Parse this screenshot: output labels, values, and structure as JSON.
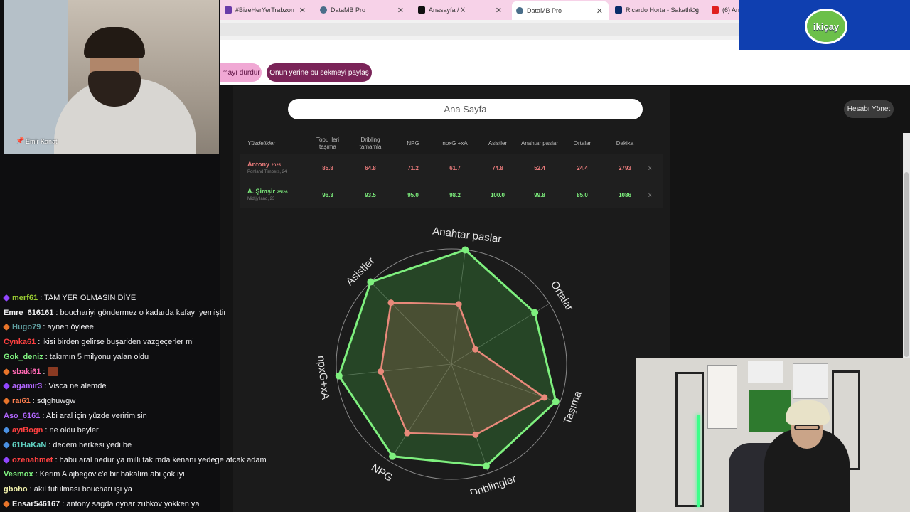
{
  "browser": {
    "tabs": [
      {
        "label": "#BizeHerYerTrabzon",
        "icon_color": "#6a3aa8",
        "active": false
      },
      {
        "label": "DataMB Pro",
        "icon_color": "#4a6e8a",
        "active": false
      },
      {
        "label": "Anasayfa / X",
        "icon_color": "#111111",
        "active": false
      },
      {
        "label": "DataMB Pro",
        "icon_color": "#4a6e8a",
        "active": true
      },
      {
        "label": "Ricardo Horta - Sakatlık g",
        "icon_color": "#0a2a6a",
        "active": false
      },
      {
        "label": "(6) An",
        "icon_color": "#e02020",
        "active": false
      }
    ],
    "share_stop_label": "mayı durdur",
    "share_this_label": "Onun yerine bu sekmeyi paylaş"
  },
  "sponsor": {
    "text": "ikiçay"
  },
  "app": {
    "search_text": "Ana Sayfa",
    "account_button": "Hesabı Yönet"
  },
  "table": {
    "headers": [
      "Yüzdelikler",
      "Topu ileri taşıma",
      "Dribling tamamla",
      "NPG",
      "npxG +xA",
      "Asistler",
      "Anahtar paslar",
      "Ortalar",
      "Dakika"
    ],
    "rows": [
      {
        "name": "Antony",
        "season": "2025",
        "club": "Portland Timbers, 24",
        "color": "#e87b7b",
        "values": [
          "85.8",
          "64.8",
          "71.2",
          "61.7",
          "74.8",
          "52.4",
          "24.4",
          "2793"
        ],
        "remove": "x"
      },
      {
        "name": "A. Şimşir",
        "season": "25/26",
        "club": "Midtjylland, 23",
        "color": "#7ef07e",
        "values": [
          "96.3",
          "93.5",
          "95.0",
          "98.2",
          "100.0",
          "99.8",
          "85.0",
          "1086"
        ],
        "remove": "x"
      }
    ]
  },
  "radar": {
    "axes": [
      "Anahtar paslar",
      "Ortalar",
      "Taşıma",
      "Driblingler",
      "NPG",
      "npxG+xA",
      "Asistler"
    ],
    "series": [
      {
        "values": [
          52.4,
          24.4,
          85.8,
          64.8,
          71.2,
          61.7,
          74.8
        ],
        "color": "#e8897a"
      },
      {
        "values": [
          99.8,
          85.0,
          96.3,
          93.5,
          95.0,
          98.2,
          100.0
        ],
        "color": "#7ef07e"
      }
    ]
  },
  "webcam1": {
    "label": "Emir Kanat"
  },
  "chat": {
    "messages": [
      {
        "user": "merf61",
        "color": "#9acd32",
        "badge": "#9146ff",
        "text": ": TAM YER OLMASIN DİYE"
      },
      {
        "user": "Emre_616161",
        "color": "#efeff1",
        "badge": "",
        "text": ": bouchariyi göndermez o kadarda kafayı yemiştir"
      },
      {
        "user": "Hugo79",
        "color": "#5f9ea0",
        "badge": "#e8742a",
        "text": ": aynen öyleee"
      },
      {
        "user": "Cynka61",
        "color": "#ff4040",
        "badge": "",
        "text": ": ikisi birden gelirse buşariden vazgeçerler mi"
      },
      {
        "user": "Gok_deniz",
        "color": "#7ef07e",
        "badge": "",
        "text": ": takımın 5 milyonu yalan oldu"
      },
      {
        "user": "sbaki61",
        "color": "#ff69b4",
        "badge": "#e8742a",
        "text": ":"
      },
      {
        "user": "agamir3",
        "color": "#b266ff",
        "badge": "#9146ff",
        "text": ": Visca ne alemde"
      },
      {
        "user": "rai61",
        "color": "#ff7f50",
        "badge": "#e8742a",
        "text": ": sdjghuwgw"
      },
      {
        "user": "Aso_6161",
        "color": "#b266ff",
        "badge": "",
        "text": ": Abi aral için yüzde veririmisin"
      },
      {
        "user": "ayiBogn",
        "color": "#ff4040",
        "badge": "#4a90e2",
        "text": ": ne oldu beyler"
      },
      {
        "user": "61HaKaN",
        "color": "#5fd0c0",
        "badge": "#4a90e2",
        "text": ": dedem herkesi yedi be"
      },
      {
        "user": "ozenahmet",
        "color": "#ff4040",
        "badge": "#9146ff",
        "text": ": habu aral nedur ya milli takımda kenanı yedege atcak adam"
      },
      {
        "user": "Vesmox",
        "color": "#7ef07e",
        "badge": "",
        "text": ": Kerim Alajbegovic'e bir bakalım abi çok iyi"
      },
      {
        "user": "gboho",
        "color": "#efefaa",
        "badge": "",
        "text": ": akıl tutulması bouchari işi ya"
      },
      {
        "user": "Ensar546167",
        "color": "#efeff1",
        "badge": "#e8742a",
        "text": ": antony sagda oynar zubkov yokken ya"
      }
    ]
  }
}
